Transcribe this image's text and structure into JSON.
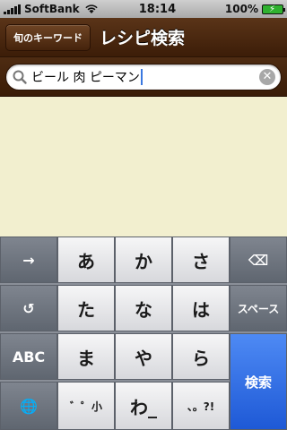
{
  "status_bar": {
    "carrier": "SoftBank",
    "time": "18:14",
    "battery": "100%"
  },
  "nav": {
    "back_label": "旬のキーワード",
    "title": "レシピ検索"
  },
  "search": {
    "value": "ビール 肉 ピーマン"
  },
  "keyboard": {
    "keys": {
      "arrow": "→",
      "a": "あ",
      "ka": "か",
      "sa": "さ",
      "delete": "⌫",
      "undo": "↺",
      "ta": "た",
      "na": "な",
      "ha": "は",
      "space": "スペース",
      "abc": "ABC",
      "ma": "ま",
      "ya": "や",
      "ra": "ら",
      "search": "検索",
      "globe": "🌐",
      "dakuten": "゛゜小",
      "wa": "わ_",
      "punct": "、。?!"
    }
  },
  "colors": {
    "nav_brown": "#4a260c",
    "content_bg": "#f2efcf",
    "search_key_blue": "#2a66e0"
  }
}
